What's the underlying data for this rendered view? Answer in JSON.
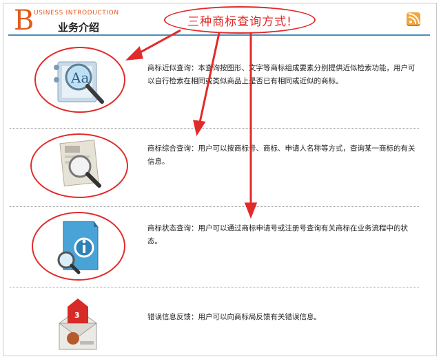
{
  "header": {
    "brand_letter": "B",
    "brand_subtitle": "USINESS INTRODUCTION",
    "title": "业务介绍",
    "rss_icon": "rss-icon"
  },
  "annotation": {
    "text": "三种商标查询方式!",
    "color": "#e32a2a"
  },
  "services": [
    {
      "icon": "magnifier-text-icon",
      "description": "商标近似查询：本查询按图形、文字等商标组成要素分别提供近似检索功能，用户可以自行检索在相同或类似商品上是否已有相同或近似的商标。"
    },
    {
      "icon": "document-magnifier-icon",
      "description": "商标综合查询：用户可以按商标号、商标、申请人名称等方式，查询某一商标的有关信息。"
    },
    {
      "icon": "info-document-icon",
      "description": "商标状态查询：用户可以通过商标申请号或注册号查询有关商标在业务流程中的状态。"
    },
    {
      "icon": "mail-badge-icon",
      "badge": "3",
      "description": "错误信息反馈：用户可以向商标局反馈有关错误信息。"
    }
  ],
  "colors": {
    "brand": "#e35a1a",
    "accent_line": "#4b8fb7",
    "annotation": "#e32a2a"
  }
}
